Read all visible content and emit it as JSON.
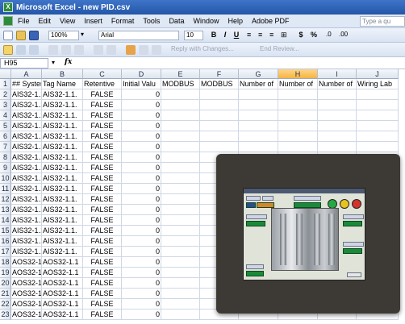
{
  "window": {
    "title": "Microsoft Excel - new PID.csv"
  },
  "menu": {
    "items": [
      "File",
      "Edit",
      "View",
      "Insert",
      "Format",
      "Tools",
      "Data",
      "Window",
      "Help",
      "Adobe PDF"
    ],
    "help_placeholder": "Type a qu"
  },
  "toolbar": {
    "zoom": "100%",
    "font": "Arial",
    "font_size": "10",
    "bold": "B",
    "italic": "I",
    "underline": "U",
    "currency": "$",
    "percent": "%",
    "reply_text": "Reply with Changes...",
    "end_review": "End Review..."
  },
  "formula_bar": {
    "name_box": "H95",
    "fx": "fx",
    "value": ""
  },
  "sheet": {
    "columns": [
      "A",
      "B",
      "C",
      "D",
      "E",
      "F",
      "G",
      "H",
      "I",
      "J"
    ],
    "selected_column": "H",
    "rows": [
      [
        "## System",
        "Tag Name",
        "Retentive",
        "Initial Valu",
        "MODBUS",
        "MODBUS",
        "Number of",
        "Number of",
        "Number of",
        "Wiring Lab"
      ],
      [
        "AIS32-1.1.",
        "AIS32-1.1.",
        "FALSE",
        "0",
        "",
        "",
        "",
        "",
        "",
        ""
      ],
      [
        "AIS32-1.1.",
        "AIS32-1.1.",
        "FALSE",
        "0",
        "",
        "",
        "",
        "",
        "",
        ""
      ],
      [
        "AIS32-1.1.",
        "AIS32-1.1.",
        "FALSE",
        "0",
        "",
        "",
        "",
        "",
        "",
        ""
      ],
      [
        "AIS32-1.1.",
        "AIS32-1.1.",
        "FALSE",
        "0",
        "",
        "",
        "",
        "",
        "",
        ""
      ],
      [
        "AIS32-1.1.",
        "AIS32-1.1.",
        "FALSE",
        "0",
        "",
        "",
        "",
        "",
        "",
        ""
      ],
      [
        "AIS32-1.1.",
        "AIS32-1.1.",
        "FALSE",
        "0",
        "",
        "",
        "",
        "",
        "",
        ""
      ],
      [
        "AIS32-1.1.",
        "AIS32-1.1.",
        "FALSE",
        "0",
        "",
        "",
        "",
        "",
        "",
        ""
      ],
      [
        "AIS32-1.1.",
        "AIS32-1.1.",
        "FALSE",
        "0",
        "",
        "",
        "",
        "",
        "",
        ""
      ],
      [
        "AIS32-1.1.",
        "AIS32-1.1.",
        "FALSE",
        "0",
        "",
        "",
        "",
        "",
        "",
        ""
      ],
      [
        "AIS32-1.1.",
        "AIS32-1.1.",
        "FALSE",
        "0",
        "",
        "",
        "",
        "",
        "",
        ""
      ],
      [
        "AIS32-1.1.",
        "AIS32-1.1.",
        "FALSE",
        "0",
        "",
        "",
        "",
        "",
        "",
        ""
      ],
      [
        "AIS32-1.1.",
        "AIS32-1.1.",
        "FALSE",
        "0",
        "",
        "",
        "",
        "",
        "",
        ""
      ],
      [
        "AIS32-1.1.",
        "AIS32-1.1.",
        "FALSE",
        "0",
        "",
        "",
        "",
        "",
        "",
        ""
      ],
      [
        "AIS32-1.1.",
        "AIS32-1.1.",
        "FALSE",
        "0",
        "",
        "",
        "",
        "",
        "",
        ""
      ],
      [
        "AIS32-1.1.",
        "AIS32-1.1.",
        "FALSE",
        "0",
        "",
        "",
        "",
        "",
        "",
        ""
      ],
      [
        "AIS32-1.1.",
        "AIS32-1.1.",
        "FALSE",
        "0",
        "",
        "",
        "",
        "",
        "",
        ""
      ],
      [
        "AOS32-1.1",
        "AOS32-1.1",
        "FALSE",
        "0",
        "",
        "",
        "",
        "",
        "",
        ""
      ],
      [
        "AOS32-1.1",
        "AOS32-1.1",
        "FALSE",
        "0",
        "",
        "",
        "",
        "",
        "",
        ""
      ],
      [
        "AOS32-1.1",
        "AOS32-1.1",
        "FALSE",
        "0",
        "",
        "",
        "",
        "",
        "",
        ""
      ],
      [
        "AOS32-1.1",
        "AOS32-1.1",
        "FALSE",
        "0",
        "",
        "",
        "",
        "",
        "",
        ""
      ],
      [
        "AOS32-1.1",
        "AOS32-1.1",
        "FALSE",
        "0",
        "",
        "",
        "",
        "",
        "",
        ""
      ],
      [
        "AOS32-1.1",
        "AOS32-1.1",
        "FALSE",
        "0",
        "",
        "",
        "",
        "",
        "",
        ""
      ]
    ]
  },
  "icons": [
    "excel-app-icon",
    "excel-doc-icon",
    "new-icon",
    "open-icon",
    "save-icon",
    "print-icon",
    "spelling-icon",
    "cut-icon",
    "copy-icon",
    "paste-icon",
    "undo-icon",
    "redo-icon"
  ],
  "colors": {
    "title_bar": "#2a5fb5",
    "selected_header": "#f5b441",
    "hmi_bezel": "#3d3a36"
  }
}
